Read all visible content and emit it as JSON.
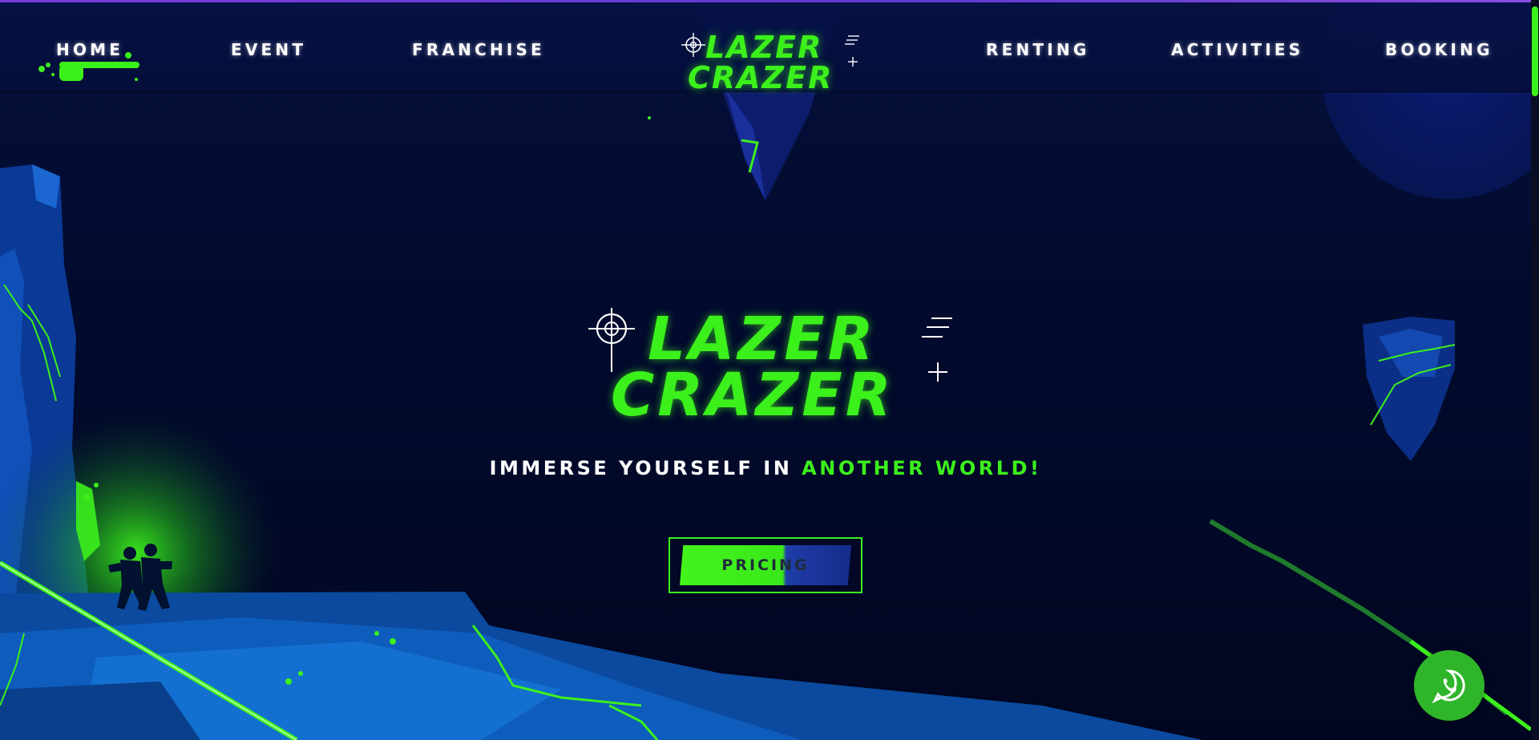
{
  "nav": {
    "items": [
      {
        "label": "HOME"
      },
      {
        "label": "EVENT"
      },
      {
        "label": "FRANCHISE"
      },
      {
        "label": "RENTING"
      },
      {
        "label": "ACTIVITIES"
      },
      {
        "label": "BOOKING"
      }
    ],
    "logo": {
      "line1": "LAZER",
      "line2": "CRAZER"
    }
  },
  "hero": {
    "logo": {
      "line1": "LAZER",
      "line2": "CRAZER"
    },
    "tagline_white": "IMMERSE YOURSELF IN",
    "tagline_green": "ANOTHER WORLD!",
    "cta_label": "PRICING"
  },
  "icons": {
    "crosshair": "crosshair-icon",
    "whatsapp": "whatsapp-icon",
    "speed_lines": "speed-lines-icon",
    "plus": "plus-icon"
  },
  "colors": {
    "accent": "#3cf01c",
    "background": "#020a2a",
    "navbar": "#061246",
    "rock": "#0b4a9e",
    "whatsapp": "#2fb52a"
  }
}
